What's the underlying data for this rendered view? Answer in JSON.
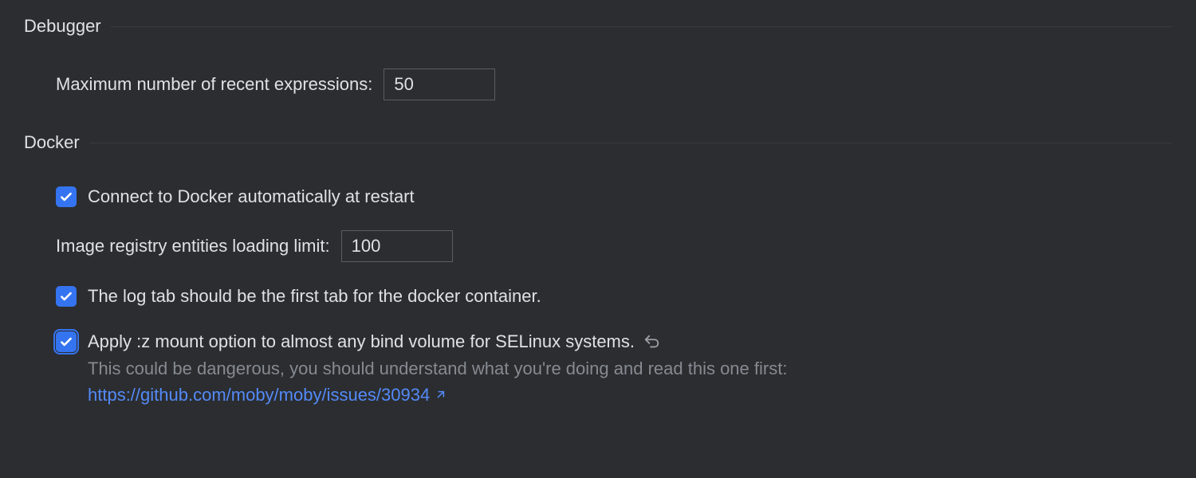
{
  "debugger": {
    "title": "Debugger",
    "max_expressions_label": "Maximum number of recent expressions:",
    "max_expressions_value": "50"
  },
  "docker": {
    "title": "Docker",
    "auto_connect_label": "Connect to Docker automatically at restart",
    "registry_limit_label": "Image registry entities loading limit:",
    "registry_limit_value": "100",
    "log_tab_first_label": "The log tab should be the first tab for the docker container.",
    "z_mount_label": "Apply :z mount option to almost any bind volume for SELinux systems.",
    "z_mount_helper": "This could be dangerous, you should understand what you're doing and read this one first:",
    "z_mount_link": "https://github.com/moby/moby/issues/30934"
  }
}
